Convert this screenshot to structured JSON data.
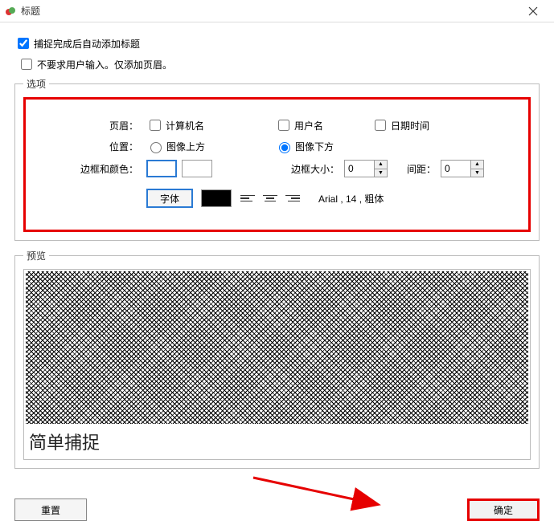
{
  "window": {
    "title": "标题"
  },
  "checkboxes": {
    "auto_add_title": {
      "label": "捕捉完成后自动添加标题",
      "checked": true
    },
    "no_user_input": {
      "label": "不要求用户输入。仅添加页眉。",
      "checked": false
    }
  },
  "groups": {
    "options": "选项",
    "preview": "预览"
  },
  "labels": {
    "header": "页眉：",
    "location": "位置：",
    "border_color": "边框和颜色：",
    "border_size": "边框大小：",
    "spacing": "间距："
  },
  "header_opts": {
    "computer_name": {
      "label": "计算机名",
      "checked": false
    },
    "user_name": {
      "label": "用户名",
      "checked": false
    },
    "date_time": {
      "label": "日期时间",
      "checked": false
    }
  },
  "location_opts": {
    "above": {
      "label": "图像上方",
      "selected": false
    },
    "below": {
      "label": "图像下方",
      "selected": true
    }
  },
  "values": {
    "border_size": "0",
    "spacing": "0"
  },
  "font": {
    "button": "字体",
    "desc": "Arial , 14 , 粗体"
  },
  "preview": {
    "caption": "简单捕捉"
  },
  "buttons": {
    "reset": "重置",
    "ok": "确定"
  }
}
